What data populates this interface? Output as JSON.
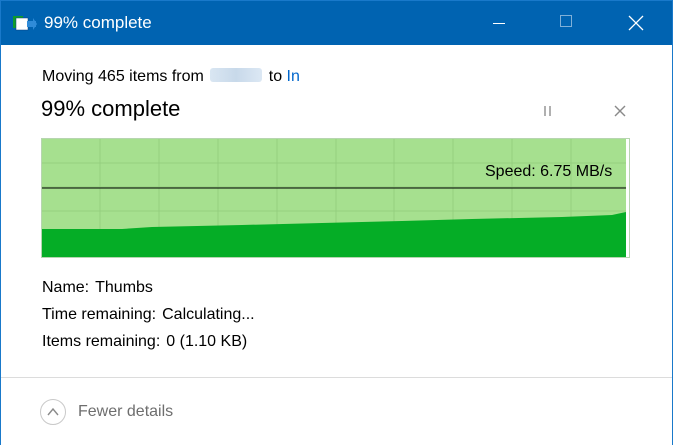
{
  "window": {
    "title": "99% complete",
    "accent_color": "#0063b1",
    "app_icon": "file-copy-icon"
  },
  "transfer": {
    "moving_prefix": "Moving 465 items from",
    "source": "",
    "to_word": "to",
    "destination": "In",
    "percent_text": "99% complete",
    "progress": 0.99
  },
  "graph": {
    "speed_text": "Speed: 6.75 MB/s",
    "fill_color": "#05ad26",
    "background_color": "#a6e08f"
  },
  "details": {
    "name_label": "Name:",
    "name_value": "Thumbs",
    "time_label": "Time remaining:",
    "time_value": "Calculating...",
    "items_label": "Items remaining:",
    "items_value": "0 (1.10 KB)"
  },
  "footer": {
    "fewer_details_label": "Fewer details"
  }
}
